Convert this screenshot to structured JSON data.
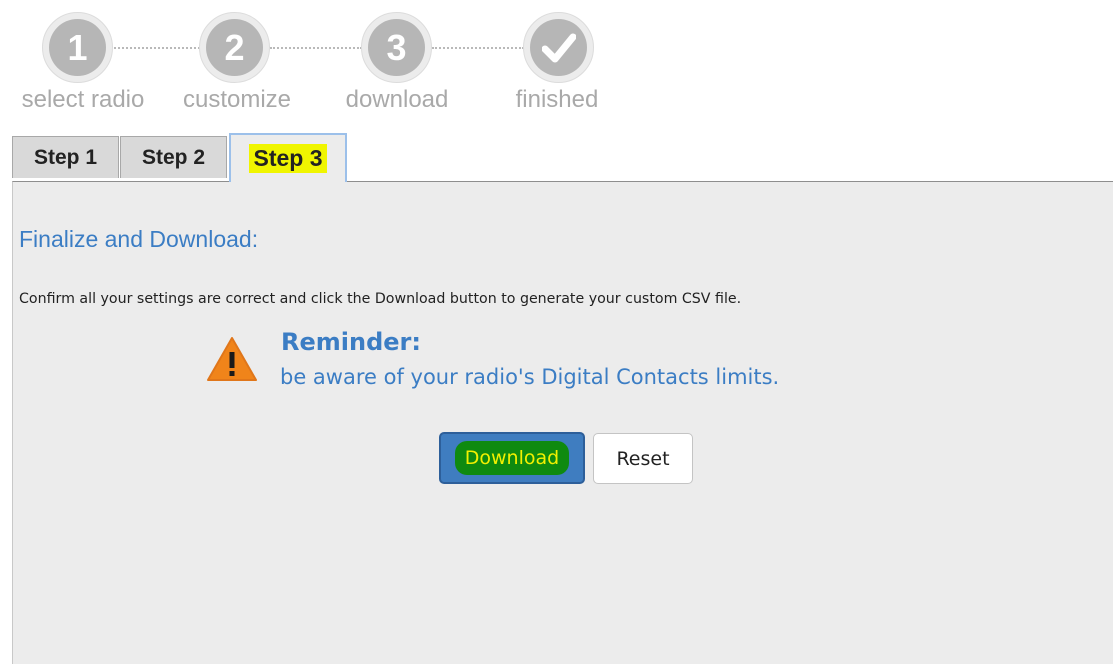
{
  "wizard": {
    "steps": [
      {
        "number": "1",
        "label": "select radio"
      },
      {
        "number": "2",
        "label": "customize"
      },
      {
        "number": "3",
        "label": "download"
      },
      {
        "number": "",
        "label": "finished",
        "icon": "checkmark-icon"
      }
    ]
  },
  "tabs": [
    {
      "label": "Step 1"
    },
    {
      "label": "Step 2"
    },
    {
      "label": "Step 3",
      "active": true
    }
  ],
  "panel": {
    "title": "Finalize and Download:",
    "text": "Confirm all your settings are correct and click the Download button to generate your custom CSV file.",
    "reminder": {
      "icon": "warning-icon",
      "title": "Reminder:",
      "text": "be aware of your radio's Digital Contacts limits."
    },
    "buttons": {
      "download": "Download",
      "reset": "Reset"
    }
  },
  "colors": {
    "accent": "#3b7dc4",
    "highlight_yellow": "#f0f500",
    "download_button": "#3f7dc0",
    "download_highlight": "#0f8a10",
    "warning_orange": "#f0841a",
    "step_gray": "#b6b6b6"
  }
}
